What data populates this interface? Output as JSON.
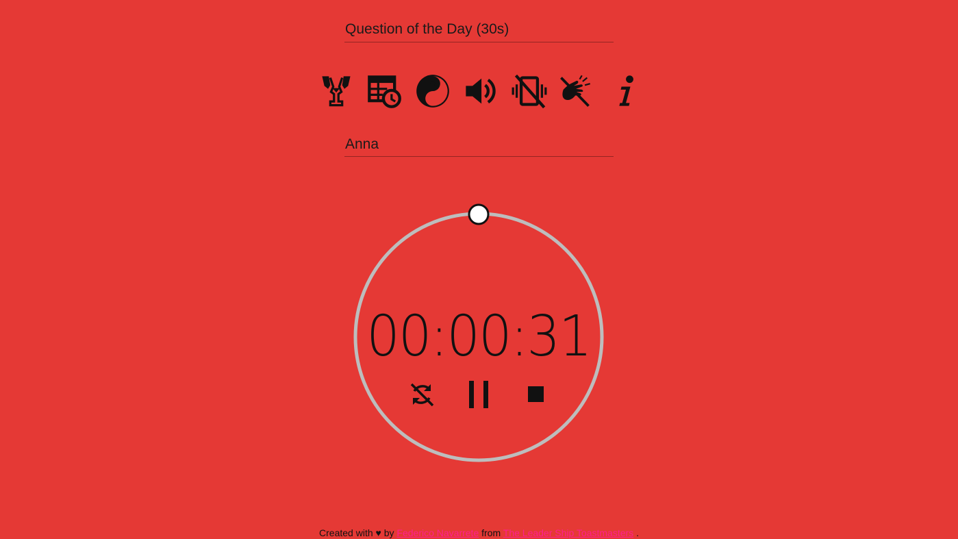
{
  "speech": {
    "type": "Question of the Day (30s)"
  },
  "speaker": {
    "name": "Anna"
  },
  "toolbar": {
    "icons": [
      "trophy-icon",
      "table-clock-icon",
      "yin-yang-icon",
      "volume-icon",
      "vibrate-off-icon",
      "clap-off-icon",
      "info-icon"
    ]
  },
  "timer": {
    "time": "00:00:31",
    "progress": 0.0,
    "ring_color": "#bdbdbd",
    "knob_color": "#ffffff"
  },
  "controls": {
    "icons": [
      "sync-off-icon",
      "pause-icon",
      "stop-icon"
    ]
  },
  "footer": {
    "prefix": "Created with ♥ by",
    "author": "Federico Navarrete",
    "middle": "from",
    "org": "The Leader Ship Toastmasters",
    "suffix": "."
  },
  "colors": {
    "background": "#e53935",
    "link": "#ff1f8e"
  }
}
